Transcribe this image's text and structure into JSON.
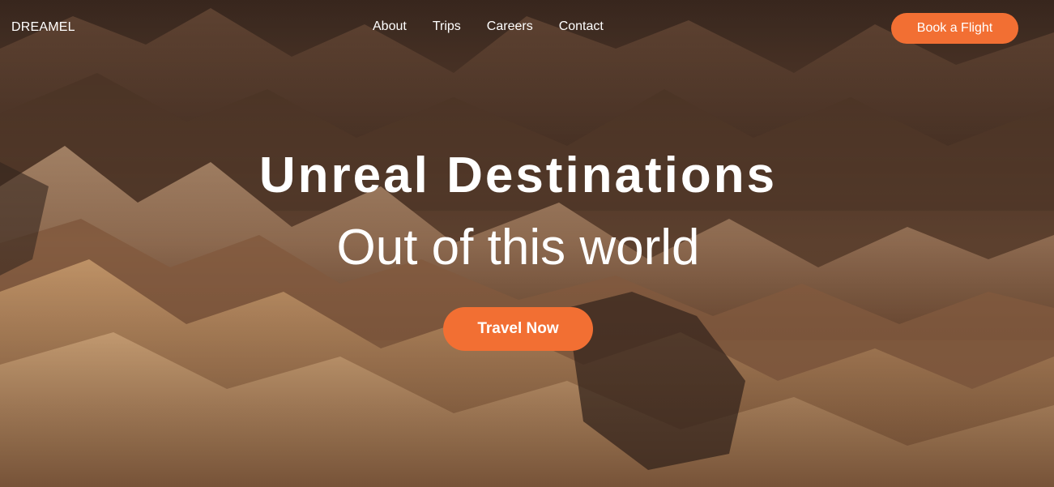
{
  "nav": {
    "logo": "DREAMEL",
    "links": [
      "About",
      "Trips",
      "Careers",
      "Contact"
    ],
    "book_button": "Book a Flight"
  },
  "hero": {
    "title": "Unreal Destinations",
    "subtitle": "Out of this world",
    "cta": "Travel Now",
    "background": "mountain-landscape-image"
  },
  "colors": {
    "accent": "#f26f33",
    "text": "#ffffff"
  }
}
